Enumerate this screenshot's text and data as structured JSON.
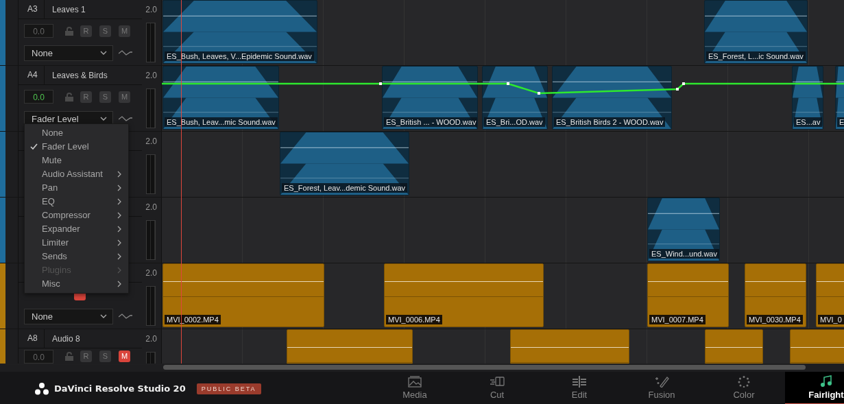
{
  "tracks": [
    {
      "id": "A3",
      "name": "Leaves 1",
      "format": "2.0",
      "color": "#1f6d9c",
      "volume": "0.0",
      "volume_active": false,
      "record": "R",
      "solo": "S",
      "mute_label": "M",
      "muted": false,
      "automation": "None",
      "clips": [
        {
          "kind": "audio",
          "name": "ES_Bush, Leaves, V...Epidemic Sound.wav"
        },
        {
          "kind": "audio",
          "name": "ES_Forest, L...ic Sound.wav"
        }
      ]
    },
    {
      "id": "A4",
      "name": "Leaves & Birds",
      "format": "2.0",
      "color": "#1f6d9c",
      "volume": "0.0",
      "volume_active": true,
      "record": "R",
      "solo": "S",
      "mute_label": "M",
      "muted": false,
      "automation": "Fader Level",
      "automation_line": true,
      "clips": [
        {
          "kind": "audio",
          "name": "ES_Bush, Leav...mic Sound.wav"
        },
        {
          "kind": "audio",
          "name": "ES_British ... - WOOD.wav"
        },
        {
          "kind": "audio",
          "name": "ES_Bri...OD.wav"
        },
        {
          "kind": "audio",
          "name": "ES_British Birds 2 - WOOD.wav"
        },
        {
          "kind": "audio",
          "name": "ES...av"
        },
        {
          "kind": "audio",
          "name": "E"
        }
      ]
    },
    {
      "format": "2.0",
      "color": "#1f6d9c",
      "clips": [
        {
          "kind": "audio",
          "name": "ES_Forest, Leav...demic Sound.wav"
        }
      ]
    },
    {
      "format": "2.0",
      "color": "#1f6d9c",
      "clips": [
        {
          "kind": "audio",
          "name": "ES_Wind...und.wav"
        }
      ]
    },
    {
      "format": "2.0",
      "color": "#b07a0c",
      "muted": true,
      "automation": "None",
      "clips": [
        {
          "kind": "video",
          "name": "MVI_0002.MP4"
        },
        {
          "kind": "video",
          "name": "MVI_0006.MP4"
        },
        {
          "kind": "video",
          "name": "MVI_0007.MP4"
        },
        {
          "kind": "video",
          "name": "MVI_0030.MP4"
        },
        {
          "kind": "video",
          "name": "MVI_0"
        }
      ]
    },
    {
      "id": "A8",
      "name": "Audio 8",
      "format": "2.0",
      "color": "#b07a0c",
      "volume": "0.0",
      "volume_active": false,
      "record": "R",
      "solo": "S",
      "mute_label": "M",
      "muted": true,
      "clips": [
        {
          "kind": "video"
        },
        {
          "kind": "video"
        },
        {
          "kind": "video"
        },
        {
          "kind": "video"
        }
      ]
    }
  ],
  "menu": [
    {
      "label": "None",
      "checked": false,
      "submenu": false,
      "disabled": false
    },
    {
      "label": "Fader Level",
      "checked": true,
      "submenu": false,
      "disabled": false
    },
    {
      "label": "Mute",
      "checked": false,
      "submenu": false,
      "disabled": false
    },
    {
      "label": "Audio Assistant",
      "checked": false,
      "submenu": true,
      "disabled": false
    },
    {
      "label": "Pan",
      "checked": false,
      "submenu": true,
      "disabled": false
    },
    {
      "label": "EQ",
      "checked": false,
      "submenu": true,
      "disabled": false
    },
    {
      "label": "Compressor",
      "checked": false,
      "submenu": true,
      "disabled": false
    },
    {
      "label": "Expander",
      "checked": false,
      "submenu": true,
      "disabled": false
    },
    {
      "label": "Limiter",
      "checked": false,
      "submenu": true,
      "disabled": false
    },
    {
      "label": "Sends",
      "checked": false,
      "submenu": true,
      "disabled": false
    },
    {
      "label": "Plugins",
      "checked": false,
      "submenu": true,
      "disabled": true
    },
    {
      "label": "Misc",
      "checked": false,
      "submenu": true,
      "disabled": false
    }
  ],
  "app": {
    "name": "DaVinci Resolve Studio 20",
    "badge": "PUBLIC BETA"
  },
  "pages": [
    {
      "kind": "media",
      "label": "Media",
      "selected": false
    },
    {
      "kind": "cut",
      "label": "Cut",
      "selected": false
    },
    {
      "kind": "edit",
      "label": "Edit",
      "selected": false
    },
    {
      "kind": "fusion",
      "label": "Fusion",
      "selected": false
    },
    {
      "kind": "color",
      "label": "Color",
      "selected": false
    },
    {
      "kind": "fairlight",
      "label": "Fairlight",
      "selected": true
    }
  ]
}
